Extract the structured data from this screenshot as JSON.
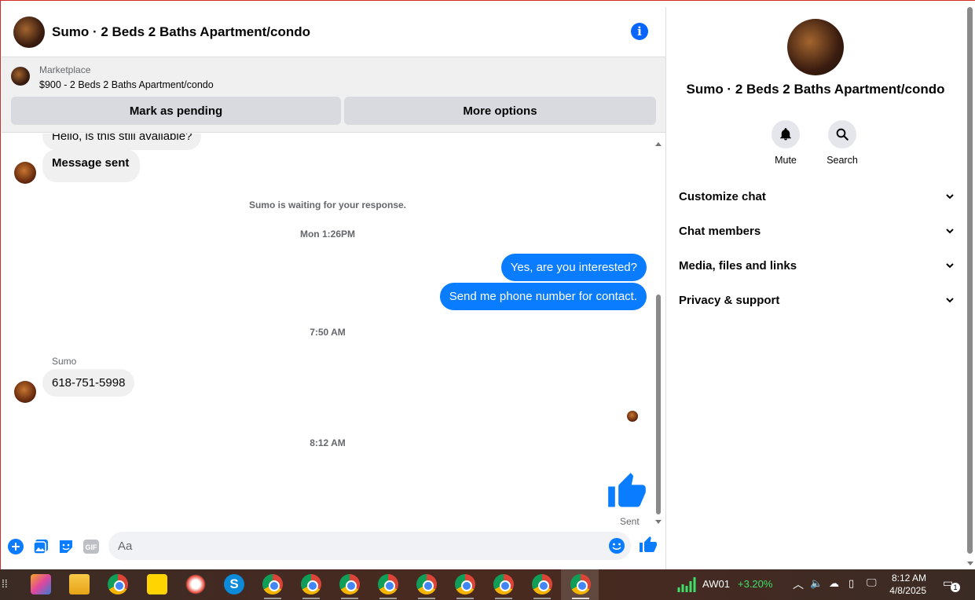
{
  "header": {
    "title": "Sumo · 2 Beds 2 Baths Apartment/condo"
  },
  "marketplace": {
    "label": "Marketplace",
    "listing": "$900 - 2 Beds 2 Baths Apartment/condo",
    "pending_button": "Mark as pending",
    "more_button": "More options"
  },
  "messages": {
    "first_partial": "Hello, is this still available?",
    "message_sent": "Message sent",
    "waiting_note": "Sumo is waiting for your response.",
    "time1": "Mon 1:26PM",
    "out1": "Yes, are you interested?",
    "out2": "Send me phone number for contact.",
    "time2": "7:50 AM",
    "sender_name": "Sumo",
    "in_phone": "618-751-5998",
    "time3": "8:12 AM",
    "sent_label": "Sent"
  },
  "composer": {
    "placeholder": "Aa"
  },
  "details": {
    "name": "Sumo · 2 Beds 2 Baths Apartment/condo",
    "mute": "Mute",
    "search": "Search",
    "sections": [
      "Customize chat",
      "Chat members",
      "Media, files and links",
      "Privacy & support"
    ]
  },
  "taskbar": {
    "ticker": "AW01",
    "change": "+3.20%",
    "time": "8:12 AM",
    "date": "4/8/2025",
    "notification_count": "1"
  },
  "colors": {
    "accent": "#0a7cff",
    "brand_blue": "#0866ff"
  }
}
